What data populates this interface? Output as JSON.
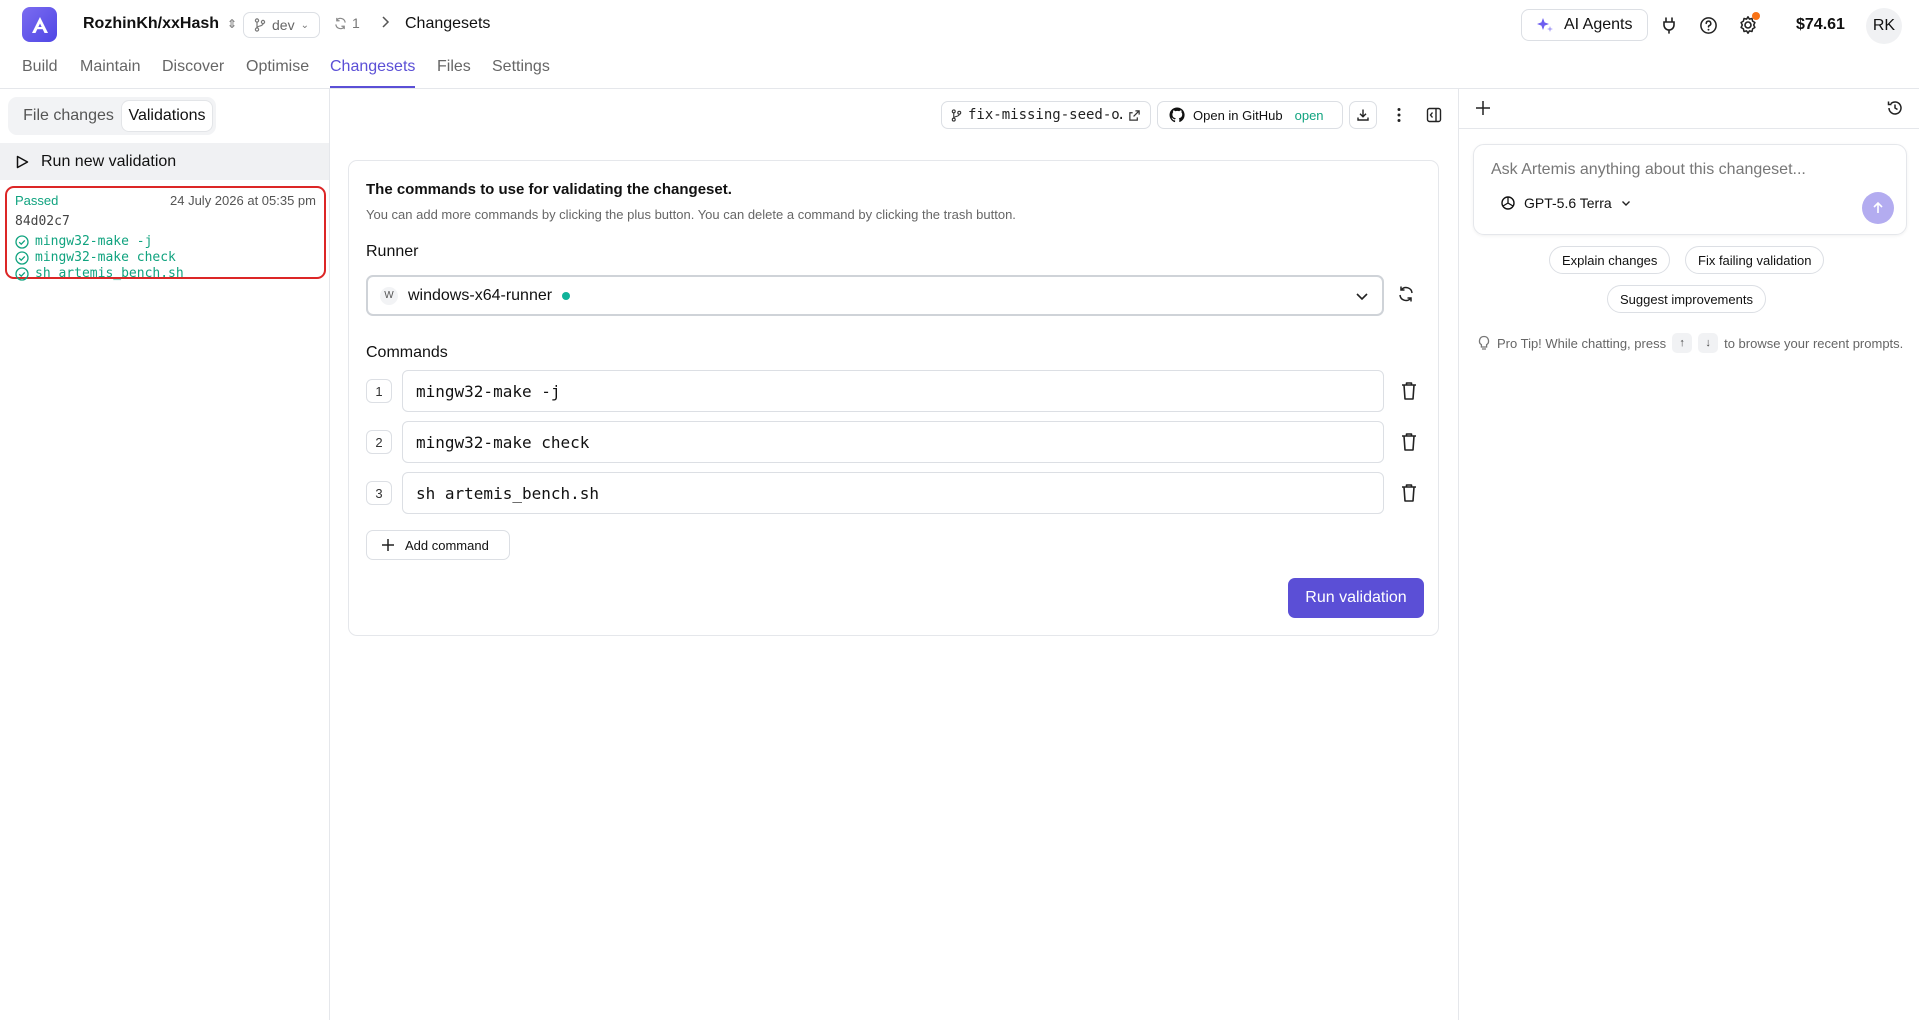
{
  "header": {
    "repo": "RozhinKh/xxHash",
    "branch": "dev",
    "sync_count": "1",
    "breadcrumb": "Changesets",
    "ai_agents_label": "AI Agents",
    "balance": "$74.61",
    "avatar_initials": "RK"
  },
  "nav": {
    "tabs": [
      "Build",
      "Maintain",
      "Discover",
      "Optimise",
      "Changesets",
      "Files",
      "Settings"
    ],
    "active": "Changesets"
  },
  "left": {
    "segments": [
      "File changes",
      "Validations"
    ],
    "active_segment": "Validations",
    "run_new_label": "Run new validation",
    "validation": {
      "status": "Passed",
      "date": "24 July 2026 at 05:35 pm",
      "commit": "84d02c7",
      "commands": [
        "mingw32-make -j",
        "mingw32-make check",
        "sh artemis_bench.sh"
      ]
    }
  },
  "toolbar": {
    "branch_chip": "fix-missing-seed-o…",
    "github_label": "Open in GitHub",
    "github_state": "open"
  },
  "form": {
    "title": "The commands to use for validating the changeset.",
    "subtitle": "You can add more commands by clicking the plus button. You can delete a command by clicking the trash button.",
    "runner_label": "Runner",
    "runner_badge": "W",
    "runner_value": "windows-x64-runner",
    "commands_label": "Commands",
    "commands": [
      {
        "num": "1",
        "value": "mingw32-make -j"
      },
      {
        "num": "2",
        "value": "mingw32-make check"
      },
      {
        "num": "3",
        "value": "sh artemis_bench.sh"
      }
    ],
    "add_command_label": "Add command",
    "run_label": "Run validation"
  },
  "chat": {
    "placeholder": "Ask Artemis anything about this changeset...",
    "model": "GPT-5.6 Terra",
    "suggestions": [
      "Explain changes",
      "Fix failing validation",
      "Suggest improvements"
    ],
    "tip_prefix": "Pro Tip! While chatting, press",
    "tip_key_up": "↑",
    "tip_key_down": "↓",
    "tip_suffix": "to browse your recent prompts."
  },
  "colors": {
    "accent": "#5b4fd6",
    "success": "#10a37f",
    "highlight_border": "#dc2626"
  }
}
